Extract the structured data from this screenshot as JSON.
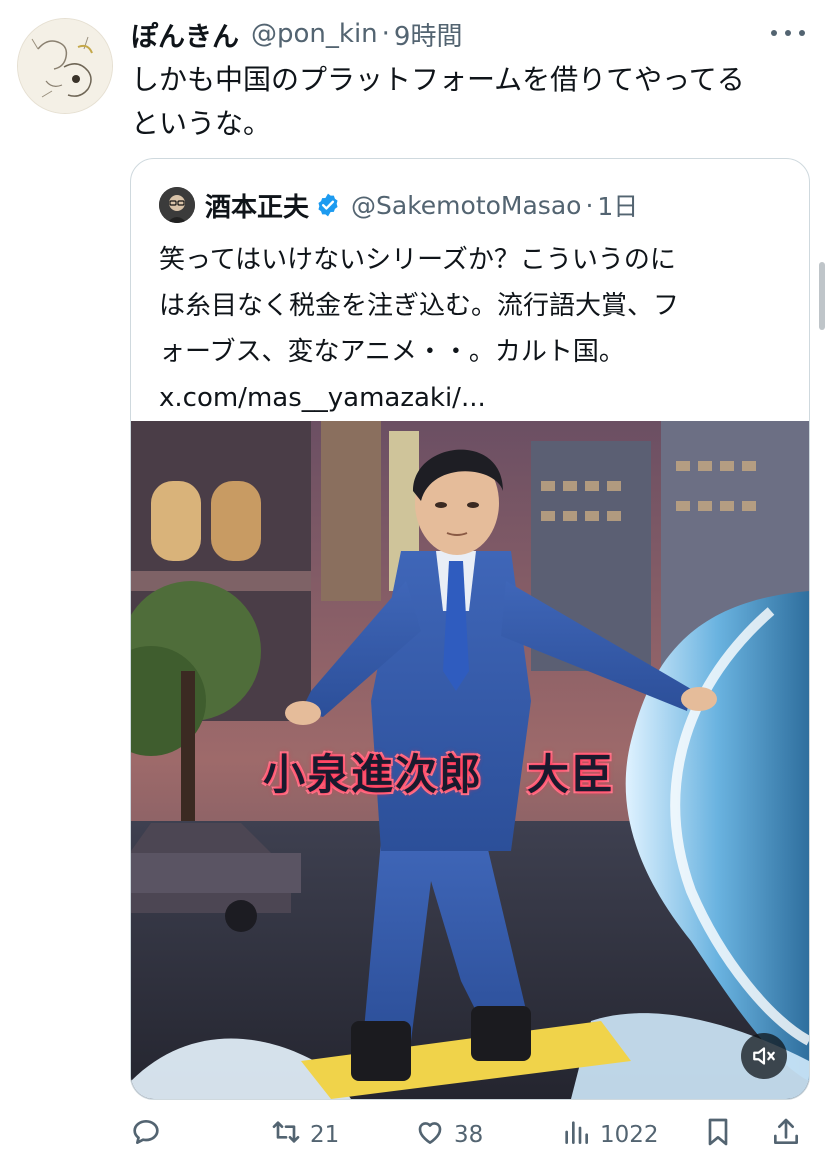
{
  "post": {
    "author_name": "ぽんきん",
    "author_handle": "@pon_kin",
    "separator": "·",
    "time": "9時間",
    "text": "しかも中国のプラットフォームを借りてやってる\nというな。"
  },
  "quoted": {
    "author_name": "酒本正夫",
    "verified": true,
    "author_handle": "@SakemotoMasao",
    "separator": "·",
    "time": "1日",
    "text": "笑ってはいけないシリーズか？こういうのに\nは糸目なく税金を注ぎ込む。流行語大賞、フ\nォーブス、変なアニメ・・。カルト国。\nx.com/mas__yamazaki/...",
    "media_caption": "小泉進次郎　大臣",
    "media_muted": true
  },
  "actions": {
    "reply_count": "",
    "retweet_count": "21",
    "like_count": "38",
    "view_count": "1022"
  },
  "icons": [
    "more-icon",
    "verified-badge-icon",
    "mute-icon",
    "reply-icon",
    "retweet-icon",
    "like-icon",
    "views-icon",
    "bookmark-icon",
    "share-icon"
  ],
  "colors": {
    "text": "#0f1419",
    "secondary": "#536471",
    "verified": "#1d9bf0",
    "border": "#cfd9de"
  }
}
